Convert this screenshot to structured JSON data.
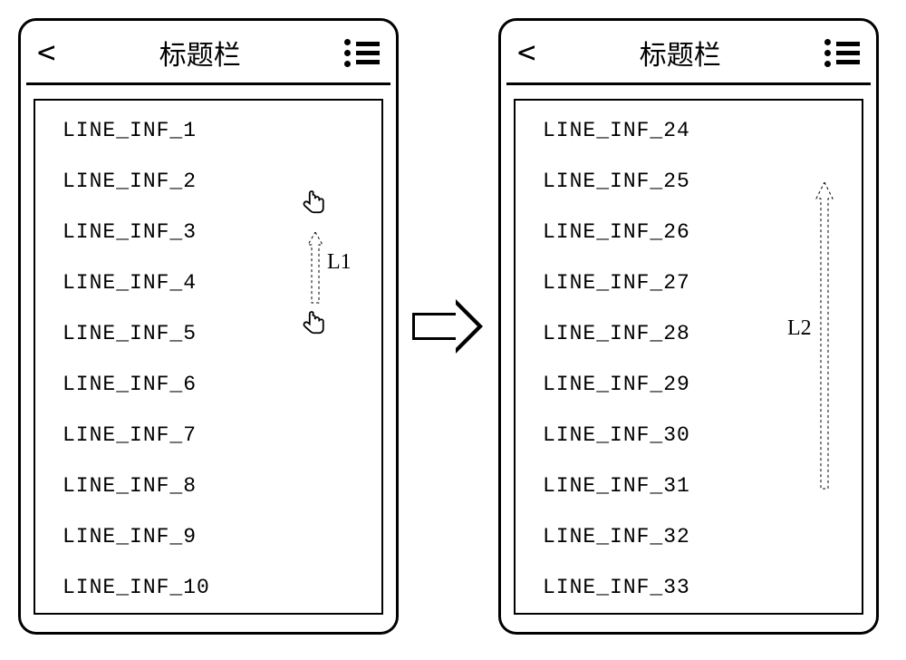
{
  "phone_left": {
    "header": {
      "back": "<",
      "title": "标题栏"
    },
    "items": {
      "i0": "LINE_INF_1",
      "i1": "LINE_INF_2",
      "i2": "LINE_INF_3",
      "i3": "LINE_INF_4",
      "i4": "LINE_INF_5",
      "i5": "LINE_INF_6",
      "i6": "LINE_INF_7",
      "i7": "LINE_INF_8",
      "i8": "LINE_INF_9",
      "i9": "LINE_INF_10"
    },
    "gesture_label": "L1"
  },
  "phone_right": {
    "header": {
      "back": "<",
      "title": "标题栏"
    },
    "items": {
      "i0": "LINE_INF_24",
      "i1": "LINE_INF_25",
      "i2": "LINE_INF_26",
      "i3": "LINE_INF_27",
      "i4": "LINE_INF_28",
      "i5": "LINE_INF_29",
      "i6": "LINE_INF_30",
      "i7": "LINE_INF_31",
      "i8": "LINE_INF_32",
      "i9": "LINE_INF_33"
    },
    "gesture_label": "L2"
  }
}
